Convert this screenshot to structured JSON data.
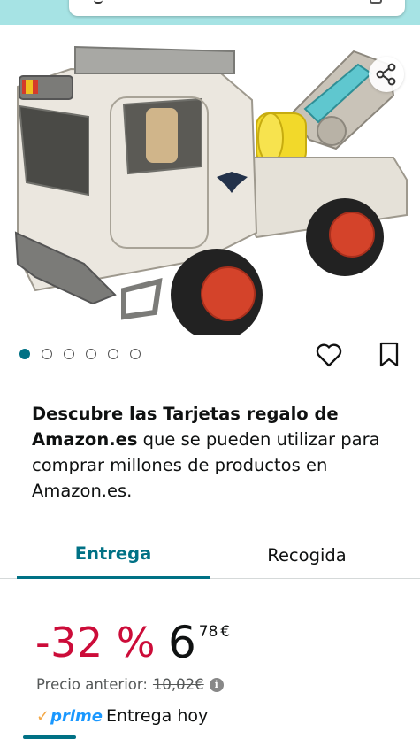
{
  "header": {
    "search": {
      "icon": "search-icon",
      "camera_icon": "camera-icon"
    }
  },
  "product": {
    "image_alt": "toy-truck-image",
    "share_icon": "share-icon",
    "carousel": {
      "total": 6,
      "active": 1
    },
    "wishlist_icon": "heart-icon",
    "save_icon": "bookmark-icon"
  },
  "promo": {
    "bold_text": "Descubre las Tarjetas regalo de Amazon.es",
    "rest_text": " que se pueden utilizar para comprar millones de productos en Amazon.es."
  },
  "tabs": [
    {
      "label": "Entrega",
      "active": true
    },
    {
      "label": "Recogida",
      "active": false
    }
  ],
  "price": {
    "discount": "-32 %",
    "whole": "6",
    "fraction": "78",
    "currency": "€",
    "previous_label": "Precio anterior:",
    "previous_value": "10,02€"
  },
  "delivery": {
    "prime_label": "prime",
    "text": "Entrega hoy"
  },
  "colors": {
    "accent": "#007185",
    "discount": "#cc0c39",
    "prime_blue": "#1a98ff",
    "prime_check": "#f3a847",
    "top_strip": "#a6e3e4"
  }
}
